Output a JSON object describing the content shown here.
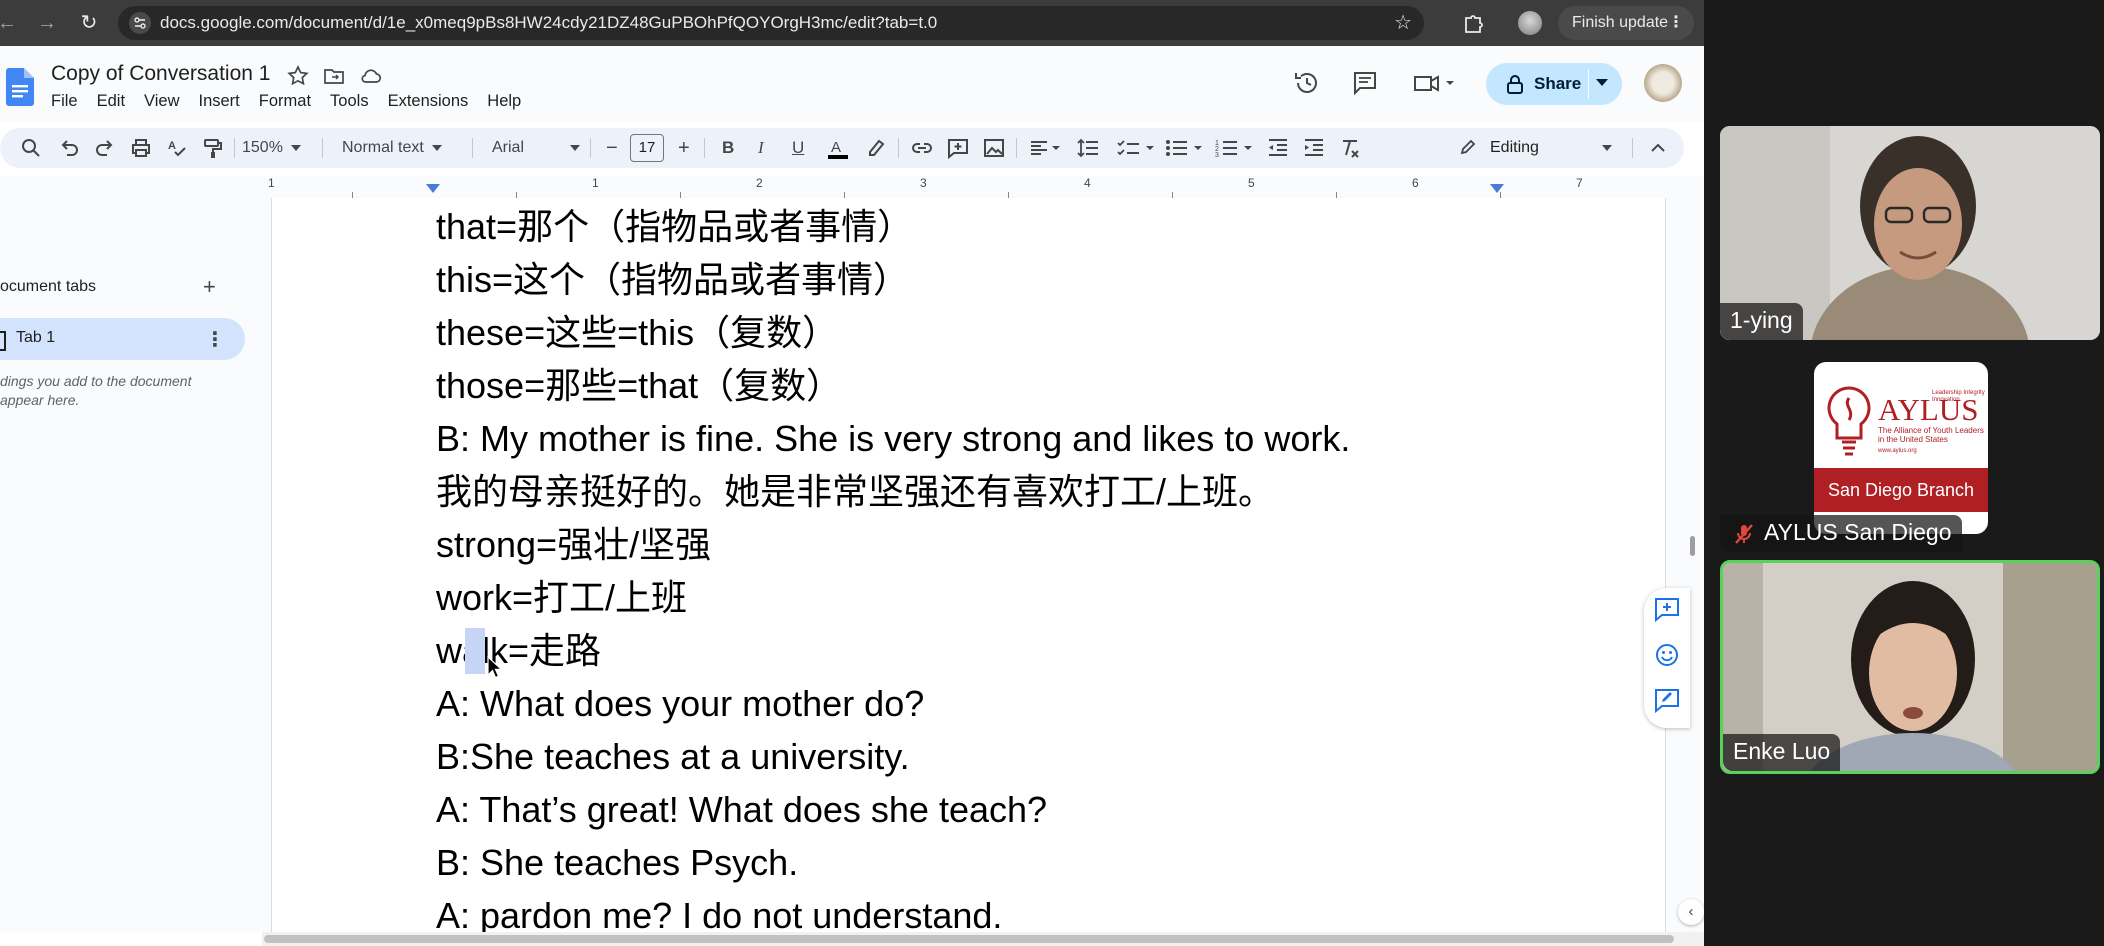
{
  "browser": {
    "url": "docs.google.com/document/d/1e_x0meq9pBs8HW24cdy21DZ48GuPBOhPfQOYOrgH3mc/edit?tab=t.0",
    "finish_update": "Finish update"
  },
  "doc": {
    "title": "Copy of Conversation 1",
    "menu": [
      "File",
      "Edit",
      "View",
      "Insert",
      "Format",
      "Tools",
      "Extensions",
      "Help"
    ],
    "share_label": "Share"
  },
  "toolbar": {
    "zoom": "150%",
    "style": "Normal text",
    "font": "Arial",
    "font_size": "17",
    "mode": "Editing"
  },
  "ruler": {
    "numbers": [
      "1",
      "1",
      "2",
      "3",
      "4",
      "5",
      "6",
      "7"
    ]
  },
  "outline": {
    "heading": "ocument tabs",
    "tab_label": "Tab 1",
    "hint_line1": "dings you add to the document",
    "hint_line2": "appear here."
  },
  "document_lines": [
    "that=那个（指物品或者事情）",
    "this=这个（指物品或者事情）",
    "these=这些=this（复数）",
    "those=那些=that（复数）",
    "B: My mother is fine. She is very strong and likes to work.",
    "我的母亲挺好的。她是非常坚强还有喜欢打工/上班。",
    "strong=强壮/坚强",
    "work=打工/上班",
    "walk=走路",
    "A: What does your mother do?",
    "B:She teaches at a university.",
    "A: That’s great! What does she teach?",
    "B: She teaches Psych.",
    "A: pardon me? I do not understand."
  ],
  "participants": [
    {
      "name": "1-ying"
    },
    {
      "name": "AYLUS San Diego",
      "muted": true
    },
    {
      "name": "Enke Luo",
      "active_speaker": true
    }
  ],
  "aylus_logo": {
    "brand": "AYLUS",
    "side_text": "Leadership Integrity Innovation",
    "tagline": "The Alliance of Youth Leaders in the United States",
    "url": "www.aylus.org",
    "branch": "San Diego Branch"
  },
  "colors": {
    "active_speaker_border": "#5ad15a",
    "share_button": "#c2e7ff",
    "tab_selected": "#d3e3fd",
    "aylus_red": "#b01f24"
  }
}
